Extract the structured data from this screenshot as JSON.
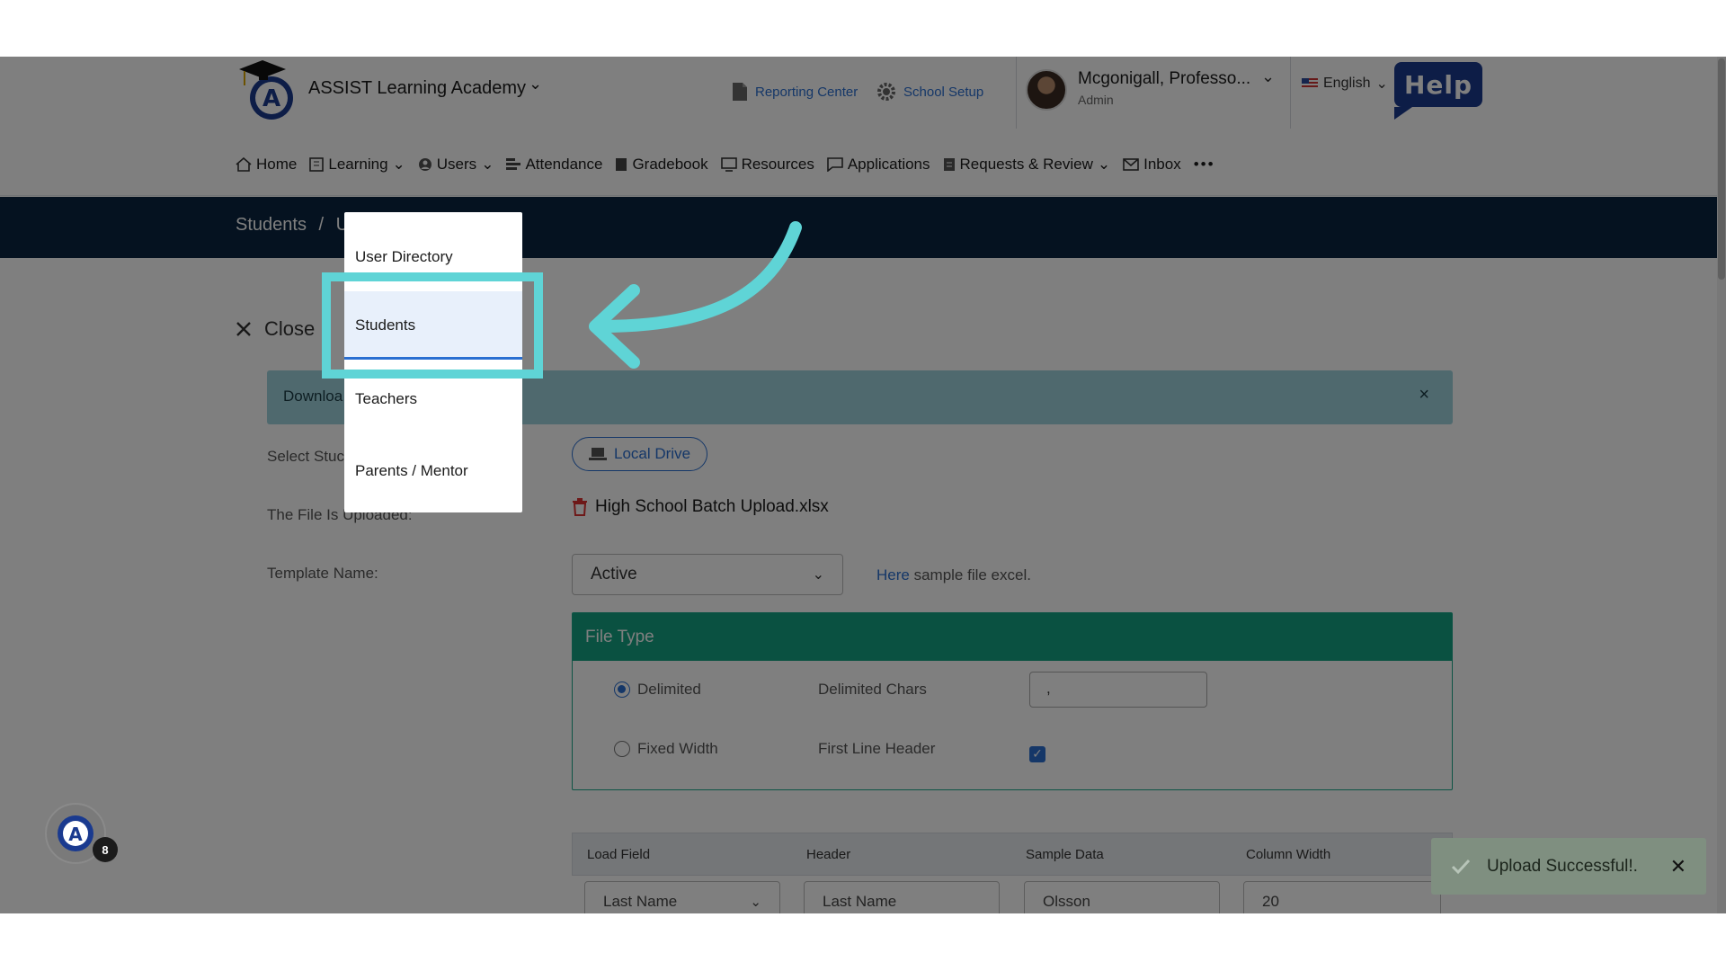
{
  "header": {
    "school_name": "ASSIST Learning Academy",
    "reporting_center": "Reporting Center",
    "school_setup": "School Setup",
    "user_name": "Mcgonigall, Professo...",
    "user_role": "Admin",
    "language": "English",
    "help_label": "Help"
  },
  "nav": {
    "items": [
      "Home",
      "Learning",
      "Users",
      "Attendance",
      "Gradebook",
      "Resources",
      "Applications",
      "Requests & Review",
      "Inbox"
    ],
    "more": "•••"
  },
  "breadcrumb": {
    "root": "Students",
    "separator": "/",
    "current": "U"
  },
  "content": {
    "close_label": "Close",
    "banner_text": "Downloa",
    "banner_close": "×",
    "select_label": "Select Stuc",
    "uploaded_label": "The File Is Uploaded:",
    "template_label": "Template Name:",
    "local_drive": "Local Drive",
    "file_name": "High School Batch Upload.xlsx",
    "template_value": "Active",
    "sample_link": "Here",
    "sample_text": " sample file excel."
  },
  "file_type": {
    "title": "File Type",
    "delimited": "Delimited",
    "fixed_width": "Fixed Width",
    "delimited_chars_label": "Delimited Chars",
    "delimited_chars_value": ",",
    "first_line_header": "First Line Header",
    "selected": "Delimited",
    "first_line_header_checked": true
  },
  "mapping": {
    "columns": [
      "Load Field",
      "Header",
      "Sample Data",
      "Column Width"
    ],
    "row": [
      "Last Name",
      "Last Name",
      "Olsson",
      "20"
    ]
  },
  "dropdown": {
    "items": [
      "User Directory",
      "Students",
      "Teachers",
      "Parents / Mentor"
    ],
    "active": "Students"
  },
  "chat": {
    "badge_count": "8"
  },
  "toast": {
    "message": "Upload Successful!.",
    "close": "✕"
  },
  "colors": {
    "accent_blue": "#2a6fd1",
    "teal_highlight": "#5fd4d6",
    "green_header": "#14a383",
    "navy_band": "#0b2540"
  }
}
